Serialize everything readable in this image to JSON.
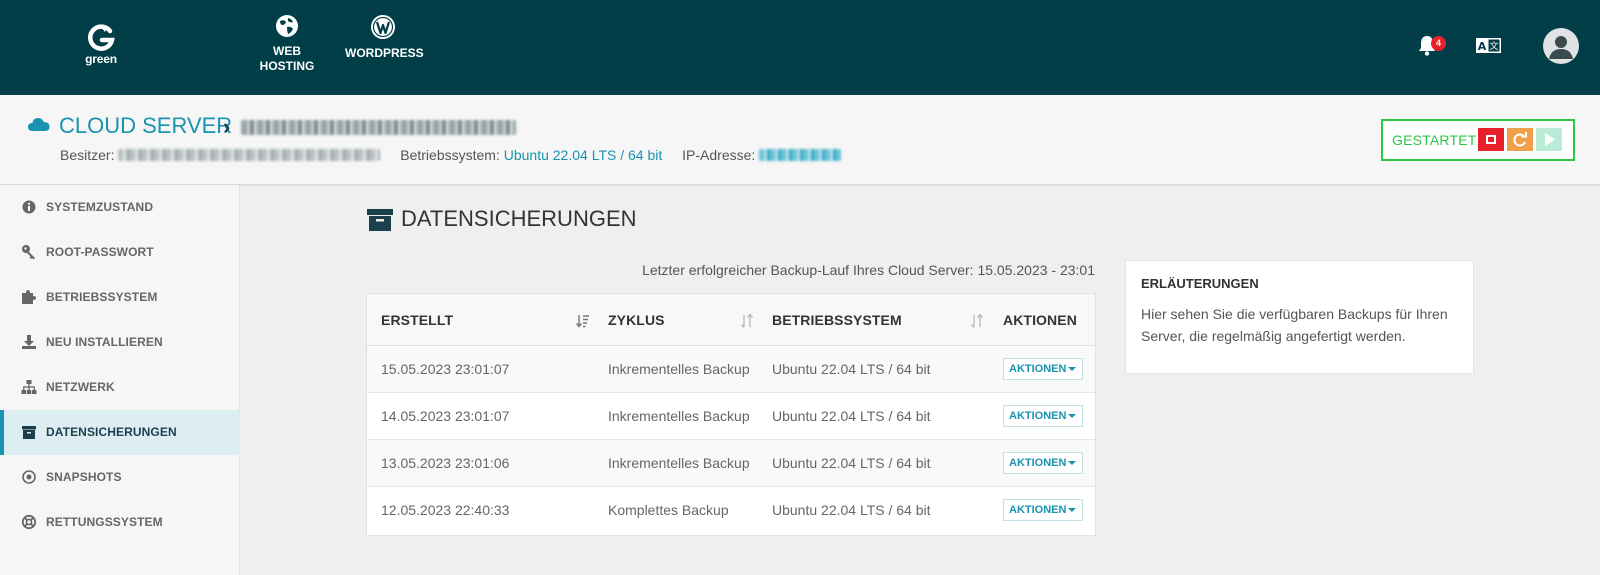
{
  "brand": {
    "logo_text": "green"
  },
  "top_nav": [
    {
      "label_line1": "WEB",
      "label_line2": "HOSTING",
      "icon": "globe-icon"
    },
    {
      "label_line1": "WORDPRESS",
      "icon": "wordpress-icon"
    }
  ],
  "notifications": {
    "count": "4"
  },
  "server": {
    "title": "CLOUD SERVER",
    "owner_label": "Besitzer:",
    "os_label": "Betriebssystem:",
    "os_value": "Ubuntu 22.04 LTS / 64 bit",
    "ip_label": "IP-Adresse:",
    "status": "GESTARTET"
  },
  "sidebar": {
    "items": [
      {
        "label": "SYSTEMZUSTAND",
        "icon": "info-icon"
      },
      {
        "label": "ROOT-PASSWORT",
        "icon": "key-icon"
      },
      {
        "label": "BETRIEBSSYSTEM",
        "icon": "puzzle-icon"
      },
      {
        "label": "NEU INSTALLIEREN",
        "icon": "download-icon"
      },
      {
        "label": "NETZWERK",
        "icon": "network-icon"
      },
      {
        "label": "DATENSICHERUNGEN",
        "icon": "archive-icon",
        "active": true
      },
      {
        "label": "SNAPSHOTS",
        "icon": "snapshot-icon"
      },
      {
        "label": "RETTUNGSSYSTEM",
        "icon": "lifebuoy-icon"
      }
    ]
  },
  "main": {
    "title": "DATENSICHERUNGEN",
    "last_backup": "Letzter erfolgreicher Backup-Lauf Ihres Cloud Server: 15.05.2023 - 23:01",
    "table": {
      "headers": [
        "ERSTELLT",
        "ZYKLUS",
        "BETRIEBSSYSTEM",
        "AKTIONEN"
      ],
      "rows": [
        {
          "created": "15.05.2023 23:01:07",
          "cycle": "Inkrementelles Backup",
          "os": "Ubuntu 22.04 LTS / 64 bit",
          "action": "AKTIONEN"
        },
        {
          "created": "14.05.2023 23:01:07",
          "cycle": "Inkrementelles Backup",
          "os": "Ubuntu 22.04 LTS / 64 bit",
          "action": "AKTIONEN"
        },
        {
          "created": "13.05.2023 23:01:06",
          "cycle": "Inkrementelles Backup",
          "os": "Ubuntu 22.04 LTS / 64 bit",
          "action": "AKTIONEN"
        },
        {
          "created": "12.05.2023 22:40:33",
          "cycle": "Komplettes Backup",
          "os": "Ubuntu 22.04 LTS / 64 bit",
          "action": "AKTIONEN"
        }
      ]
    }
  },
  "info_panel": {
    "title": "ERLÄUTERUNGEN",
    "body": "Hier sehen Sie die verfügbaren Backups für Ihren Server, die regelmäßig angefertigt werden."
  },
  "colors": {
    "topbar": "#013e47",
    "accent": "#1a93b0",
    "status_green": "#2fc446",
    "stop_red": "#e8202a",
    "restart_orange": "#f0a04b",
    "play_mint": "#b9ebd7"
  }
}
